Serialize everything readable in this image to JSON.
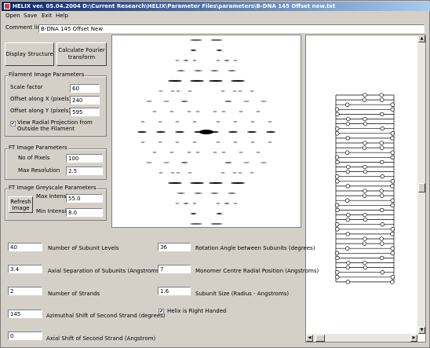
{
  "window": {
    "title": "HELIX ver. 05.04.2004  D:\\Current Research\\HELIX\\Parameter Files\\parameters\\B-DNA 145 Offset new.txt"
  },
  "menu": {
    "items": [
      "Open",
      "Save",
      "Exit",
      "Help"
    ]
  },
  "comment": {
    "label": "Comment line",
    "value": "B-DNA 145 Offset New"
  },
  "buttons": {
    "display_structure": "Display Structure",
    "calculate_fourier": "Calculate  Fourier transform",
    "refresh_image": "Refresh Image"
  },
  "filament": {
    "title": "Filament Image Parameters",
    "scale_label": "Scale factor",
    "scale_value": "60",
    "offset_x_label": "Offset along X (pixels)",
    "offset_x_value": "240",
    "offset_y_label": "Offset along Y (pixels)",
    "offset_y_value": "595",
    "radial_label": "View Radial Projection from Outside the Filament",
    "radial_checked": true
  },
  "ft": {
    "title": "FT Image Parameters",
    "pixels_label": "No of Pixels",
    "pixels_value": "100",
    "maxres_label": "Max Resolution",
    "maxres_value": "2.5"
  },
  "grey": {
    "title": "FT Image Greyscale Parameters",
    "max_label": "Max Intensity",
    "max_value": "55.0",
    "min_label": "Min Intensity",
    "min_value": "8.0"
  },
  "params_left": [
    {
      "value": "40",
      "label": "Number of Subunit Levels"
    },
    {
      "value": "3.4",
      "label": "Axial Separation of Subunits (Angstroms)"
    },
    {
      "value": "2",
      "label": "Number of Strands"
    },
    {
      "value": "145",
      "label": "Azimuthal Shift of Second Strand (degrees)"
    },
    {
      "value": "0",
      "label": "Axial Shift of Second Strand (Angstrom)"
    }
  ],
  "params_right": [
    {
      "value": "36",
      "label": "Rotation Angle between Subunits (degrees)"
    },
    {
      "value": "7",
      "label": "Monomer Centre Radial Position (Angstroms)"
    },
    {
      "value": "1.6",
      "label": "Subunit Size (Radius - Angstroms)"
    }
  ],
  "right_handed": {
    "label": "Helix is Right Handed",
    "checked": true
  },
  "icons": {
    "app": "helix-app-icon",
    "scroll_up": "scroll-up-arrow-icon",
    "scroll_down": "scroll-down-arrow-icon",
    "scroll_left": "scroll-left-arrow-icon",
    "scroll_right": "scroll-right-arrow-icon"
  }
}
